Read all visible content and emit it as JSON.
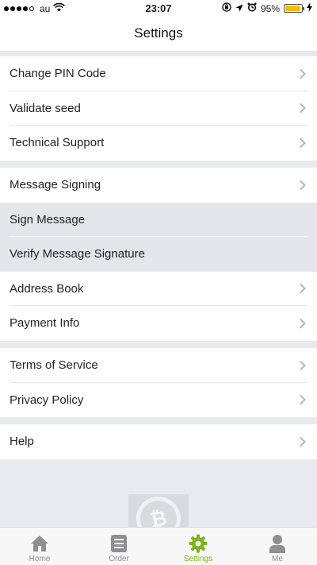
{
  "status_bar": {
    "carrier": "au",
    "time": "23:07",
    "battery": "95%",
    "battery_level": 0.95
  },
  "nav": {
    "title": "Settings"
  },
  "groups": [
    {
      "items": [
        "Change PIN Code",
        "Validate seed",
        "Technical Support"
      ]
    },
    {
      "items": [
        "Message Signing",
        "Sign Message",
        "Verify Message Signature",
        "Address Book",
        "Payment Info"
      ]
    },
    {
      "items": [
        "Terms of Service",
        "Privacy Policy"
      ]
    },
    {
      "items": [
        "Help"
      ]
    }
  ],
  "tabs": [
    {
      "label": "Home",
      "icon": "home-icon"
    },
    {
      "label": "Order",
      "icon": "order-icon"
    },
    {
      "label": "Settings",
      "icon": "settings-icon"
    },
    {
      "label": "Me",
      "icon": "me-icon"
    }
  ],
  "active_tab": "Settings",
  "colors": {
    "accent": "#7ab51d",
    "battery": "#f6c000",
    "background": "#e9eaed"
  }
}
